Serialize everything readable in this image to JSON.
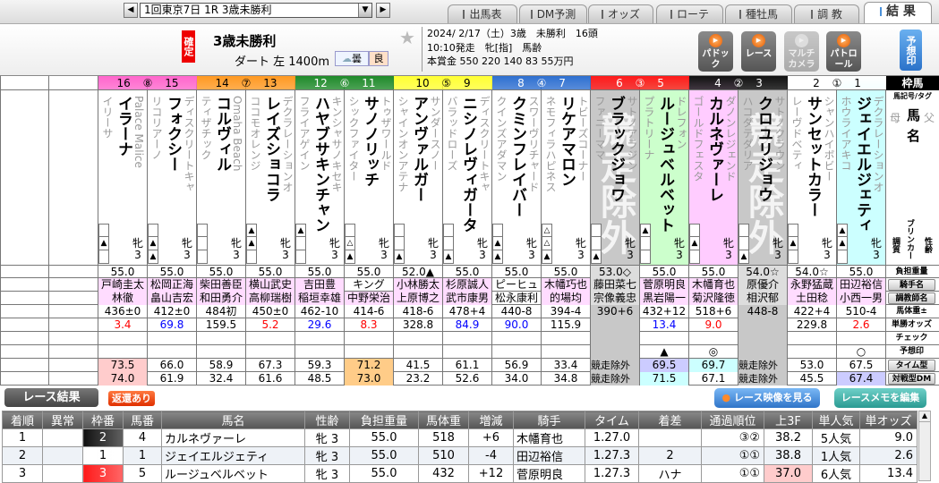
{
  "nav": {
    "race_select": "1回東京7日 1R 3歳未勝利",
    "prev": "◀",
    "next": "▶",
    "dropdown": "▼"
  },
  "tabs": [
    {
      "label": "出馬表"
    },
    {
      "label": "DM予測"
    },
    {
      "label": "オッズ"
    },
    {
      "label": "ローテ"
    },
    {
      "label": "種牡馬"
    },
    {
      "label": "調 教"
    },
    {
      "label": "結 果",
      "active": true
    }
  ],
  "header": {
    "status": "確定",
    "race_name": "3歳未勝利",
    "course": "ダート 左 1400m",
    "weather": "曇",
    "going": "良",
    "info": [
      "2024/ 2/17（土）3歳　未勝利　16頭",
      "10:10発走　牝[指]　馬齢",
      "本賞金 550 220 140 83 55万円"
    ],
    "buttons": [
      {
        "label": "パドック"
      },
      {
        "label": "レース"
      },
      {
        "label": "マルチカメラ",
        "disabled": true
      },
      {
        "label": "パトロール"
      }
    ],
    "yoso": "予想印"
  },
  "frames": [
    {
      "label": "16 ⑧ 15",
      "color": "#ff66cc",
      "text": "#000"
    },
    {
      "label": "14 ⑦ 13",
      "color": "#ff9922",
      "text": "#000"
    },
    {
      "label": "12 ⑥ 11",
      "color": "#1f8a2a",
      "text": "#fff"
    },
    {
      "label": "10 ⑤ 9",
      "color": "#ffff33",
      "text": "#000"
    },
    {
      "label": "8 ④ 7",
      "color": "#2e6fd0",
      "text": "#fff"
    },
    {
      "label": "6 ③ 5",
      "color": "#ff1a1a",
      "text": "#fff"
    },
    {
      "label": "4 ② 3",
      "color": "#111111",
      "text": "#fff"
    },
    {
      "label": "2 ① 1",
      "color": "#ffffff",
      "text": "#000"
    }
  ],
  "scratch_label": "競走除外",
  "horses": [
    {
      "no": 16,
      "name": "イラーナ",
      "sire": "Palace Malice",
      "dam": "イリーサ",
      "sexage": "牝3",
      "marks": [
        "",
        "▲",
        ""
      ],
      "bg": "#fff",
      "weight": "55.0",
      "jockey": "戸崎圭太",
      "jp": true,
      "trainer": "林徹",
      "tp": true,
      "body": "436±0",
      "odds": "3.4",
      "oc": "#f00",
      "mark": "",
      "tdm": "73.5",
      "tbg": "#ffcccc",
      "vdm": "74.0",
      "vbg": "#ffcccc"
    },
    {
      "no": 15,
      "name": "フォクシー",
      "sire": "ディスクリートキャ",
      "dam": "リコリアーノ",
      "sexage": "牝3",
      "marks": [
        "",
        "▲",
        "▲"
      ],
      "bg": "#fff",
      "weight": "55.0",
      "jockey": "松岡正海",
      "jp": true,
      "trainer": "畠山吉宏",
      "tp": true,
      "body": "412±0",
      "odds": "69.8",
      "oc": "#00f",
      "mark": "",
      "tdm": "66.0",
      "tbg": "",
      "vdm": "61.9",
      "vbg": ""
    },
    {
      "no": 14,
      "name": "コルヴィル",
      "sire": "Omaha Beach",
      "dam": "ティザチック",
      "sexage": "牝3",
      "marks": [
        "",
        "",
        ""
      ],
      "bg": "#fff",
      "weight": "55.0",
      "jockey": "柴田善臣",
      "jp": true,
      "trainer": "和田勇介",
      "tp": true,
      "body": "484初",
      "odds": "159.5",
      "oc": "#000",
      "mark": "",
      "tdm": "58.9",
      "tbg": "",
      "vdm": "32.4",
      "vbg": ""
    },
    {
      "no": 13,
      "name": "レイズショコラ",
      "sire": "デクラレーションオ",
      "dam": "ココモオレンジ",
      "sexage": "牝3",
      "marks": [
        "▲",
        "▲",
        ""
      ],
      "bg": "#fff",
      "weight": "55.0",
      "jockey": "横山武史",
      "jp": true,
      "trainer": "高柳瑞樹",
      "tp": true,
      "body": "450±0",
      "odds": "5.2",
      "oc": "#f00",
      "mark": "",
      "tdm": "67.3",
      "tbg": "",
      "vdm": "61.6",
      "vbg": ""
    },
    {
      "no": 12,
      "name": "ハヤブサキンチャン",
      "sire": "キンシャサノキセキ",
      "dam": "フライアゲイン",
      "sexage": "牝3",
      "marks": [
        "▲",
        "",
        ""
      ],
      "bg": "#fff",
      "weight": "55.0",
      "jockey": "吉田豊",
      "jp": true,
      "trainer": "稲垣幸雄",
      "tp": true,
      "body": "462-10",
      "odds": "29.6",
      "oc": "#00f",
      "mark": "",
      "tdm": "59.3",
      "tbg": "",
      "vdm": "48.5",
      "vbg": ""
    },
    {
      "no": 11,
      "name": "サノノリッチ",
      "sire": "トゥザワールド",
      "dam": "シックファイター",
      "sexage": "牝3",
      "marks": [
        "",
        "△",
        "▲"
      ],
      "bg": "#fff",
      "weight": "55.0",
      "jockey": "キング",
      "jp": false,
      "trainer": "中野栄治",
      "tp": true,
      "body": "414-6",
      "odds": "8.3",
      "oc": "#f00",
      "mark": "",
      "tdm": "71.2",
      "tbg": "#ffcc88",
      "vdm": "73.0",
      "vbg": "#ffcc88"
    },
    {
      "no": 10,
      "name": "アンヴァルガー",
      "sire": "サンダースノー",
      "dam": "シャインオンアテナ",
      "sexage": "牝3",
      "marks": [
        "",
        "",
        "▲"
      ],
      "bg": "#fff",
      "weight": "52.0▲",
      "jockey": "小林勝太",
      "jp": true,
      "trainer": "上原博之",
      "tp": true,
      "body": "418-6",
      "odds": "328.8",
      "oc": "#000",
      "mark": "",
      "tdm": "41.5",
      "tbg": "",
      "vdm": "23.2",
      "vbg": ""
    },
    {
      "no": 9,
      "name": "ニシノレヴィガータ",
      "sire": "ディスクリートキャ",
      "dam": "バラッドローズ",
      "sexage": "牝3",
      "marks": [
        "",
        "",
        "▲"
      ],
      "bg": "#fff",
      "weight": "55.0",
      "jockey": "杉原誠人",
      "jp": true,
      "trainer": "武市康男",
      "tp": true,
      "body": "478+4",
      "odds": "84.9",
      "oc": "#00f",
      "mark": "",
      "tdm": "61.1",
      "tbg": "",
      "vdm": "52.6",
      "vbg": ""
    },
    {
      "no": 8,
      "name": "クミンフレイバー",
      "sire": "スワーヴリチャード",
      "dam": "クインズアダマン",
      "sexage": "牝3",
      "marks": [
        "",
        "▲",
        "▲"
      ],
      "bg": "#fff",
      "weight": "55.0",
      "jockey": "ピーヒュ",
      "jp": false,
      "trainer": "松永康利",
      "tp": false,
      "body": "440-8",
      "odds": "90.0",
      "oc": "#00f",
      "mark": "",
      "tdm": "56.9",
      "tbg": "",
      "vdm": "34.0",
      "vbg": ""
    },
    {
      "no": 7,
      "name": "リケアマロン",
      "sire": "トビーズコーナー",
      "dam": "ネモフィラハピネス",
      "sexage": "牝3",
      "marks": [
        "△",
        "△",
        "▲"
      ],
      "bg": "#fff",
      "weight": "55.0",
      "jockey": "木幡巧也",
      "jp": true,
      "trainer": "的場均",
      "tp": true,
      "body": "394-4",
      "odds": "115.9",
      "oc": "#000",
      "mark": "",
      "tdm": "33.4",
      "tbg": "",
      "vdm": "34.8",
      "vbg": ""
    },
    {
      "no": 6,
      "name": "ブラックジョワ",
      "sire": "サトノアラジン",
      "dam": "ファニーママ",
      "sexage": "牝3",
      "marks": [
        "",
        "",
        "▲"
      ],
      "bg": "#c8c8c8",
      "scratched": true,
      "weight": "53.0◇",
      "jockey": "藤田菜七",
      "jp": true,
      "trainer": "宗像義忠",
      "tp": true,
      "body": "390+6",
      "odds": "",
      "oc": "#000",
      "mark": "",
      "tdm": "競走除外",
      "tbg": "",
      "vdm": "競走除外",
      "vbg": ""
    },
    {
      "no": 5,
      "name": "ルージュベルベット",
      "sire": "ドレフォン",
      "dam": "プラトリーナ",
      "sexage": "牝3",
      "marks": [
        "▲",
        "",
        ""
      ],
      "bg": "#ccffcc",
      "weight": "55.0",
      "jockey": "菅原明良",
      "jp": true,
      "trainer": "黒岩陽一",
      "tp": true,
      "body": "432+12",
      "odds": "13.4",
      "oc": "#00f",
      "mark": "▲",
      "tdm": "69.5",
      "tbg": "#ccccff",
      "vdm": "71.5",
      "vbg": "#ccffff"
    },
    {
      "no": 4,
      "name": "カルネヴァーレ",
      "sire": "ダノンレジェンド",
      "dam": "ゴールドフェスタ",
      "sexage": "牝3",
      "marks": [
        "",
        "▲",
        ""
      ],
      "bg": "#ffccff",
      "weight": "55.0",
      "jockey": "木幡育也",
      "jp": true,
      "trainer": "菊沢隆徳",
      "tp": true,
      "body": "518+6",
      "odds": "9.0",
      "oc": "#f00",
      "mark": "◎",
      "tdm": "69.7",
      "tbg": "#ccffff",
      "vdm": "67.1",
      "vbg": ""
    },
    {
      "no": 3,
      "name": "クロユリジョウ",
      "sire": "サトノクラウン",
      "dam": "ハコダテダリア",
      "sexage": "牝3",
      "marks": [
        "",
        "",
        "▲"
      ],
      "bg": "#c8c8c8",
      "scratched": true,
      "weight": "54.0☆",
      "jockey": "原優介",
      "jp": false,
      "trainer": "相沢郁",
      "tp": false,
      "body": "448-8",
      "odds": "",
      "oc": "#000",
      "mark": "",
      "tdm": "競走除外",
      "tbg": "",
      "vdm": "競走除外",
      "vbg": ""
    },
    {
      "no": 2,
      "name": "サンセットカラー",
      "sire": "シャンハイボビー",
      "dam": "レーヴドベティ",
      "sexage": "牝3",
      "marks": [
        "",
        "▲",
        ""
      ],
      "bg": "#fff",
      "weight": "54.0☆",
      "jockey": "永野猛蔵",
      "jp": true,
      "trainer": "土田稔",
      "tp": true,
      "body": "422+4",
      "odds": "229.8",
      "oc": "#000",
      "mark": "",
      "tdm": "53.0",
      "tbg": "",
      "vdm": "45.5",
      "vbg": ""
    },
    {
      "no": 1,
      "name": "ジェイエルジェティ",
      "sire": "デクラレーションオ",
      "dam": "ホウライアキコ",
      "sexage": "牝3",
      "marks": [
        "▲",
        "▲",
        ""
      ],
      "bg": "#ccffff",
      "weight": "55.0",
      "jockey": "田辺裕信",
      "jp": true,
      "trainer": "小西一男",
      "tp": true,
      "body": "510-4",
      "odds": "2.6",
      "oc": "#f00",
      "mark": "○",
      "tdm": "67.5",
      "tbg": "",
      "vdm": "67.4",
      "vbg": "#ccccff"
    }
  ],
  "legend": {
    "head": "枠馬",
    "tag": "馬記号/タグ",
    "dam": "母",
    "name": "馬名",
    "sire": "父",
    "temper": "調質",
    "blinker": "ブリンカー",
    "sexage": "性齢",
    "rows": [
      {
        "label": "負担重量",
        "btn": false
      },
      {
        "label": "騎手名",
        "btn": true
      },
      {
        "label": "調教師名",
        "btn": true
      },
      {
        "label": "馬体重±",
        "btn": false
      },
      {
        "label": "単勝オッズ",
        "btn": false
      },
      {
        "label": "チェック",
        "btn": false
      },
      {
        "label": "予想印",
        "btn": false
      },
      {
        "label": "タイム型DM",
        "btn": true
      },
      {
        "label": "対戦型DM",
        "btn": true
      }
    ]
  },
  "results": {
    "title": "レース結果",
    "refund": "返還あり",
    "video_btn": "レース映像を見る",
    "memo_btn": "レースメモを編集",
    "columns": [
      "着順",
      "異常",
      "枠番",
      "馬番",
      "馬名",
      "性齢",
      "負担重量",
      "馬体重",
      "増減",
      "騎手",
      "タイム",
      "着差",
      "通過順位",
      "上3F",
      "単人気",
      "単オッズ"
    ],
    "rows": [
      {
        "cells": [
          "1",
          "",
          "2",
          "4",
          "カルネヴァーレ",
          "牝 3",
          "55.0",
          "518",
          "+6",
          "木幡育也",
          "1.27.0",
          "",
          "③②",
          "38.2",
          "5人気",
          "9.0"
        ],
        "frame_bg": "#111111",
        "frame_fg": "#fff",
        "f3_bg": ""
      },
      {
        "cells": [
          "2",
          "",
          "1",
          "1",
          "ジェイエルジェティ",
          "牝 3",
          "55.0",
          "510",
          "-4",
          "田辺裕信",
          "1.27.3",
          "2",
          "①①",
          "38.8",
          "1人気",
          "2.6"
        ],
        "frame_bg": "#ffffff",
        "frame_fg": "#000",
        "f3_bg": ""
      },
      {
        "cells": [
          "3",
          "",
          "3",
          "5",
          "ルージュベルベット",
          "牝 3",
          "55.0",
          "432",
          "+12",
          "菅原明良",
          "1.27.3",
          "ハナ",
          "①①",
          "37.0",
          "6人気",
          "13.4"
        ],
        "frame_bg": "#ff1a1a",
        "frame_fg": "#fff",
        "f3_bg": "#ffcccc"
      }
    ]
  }
}
